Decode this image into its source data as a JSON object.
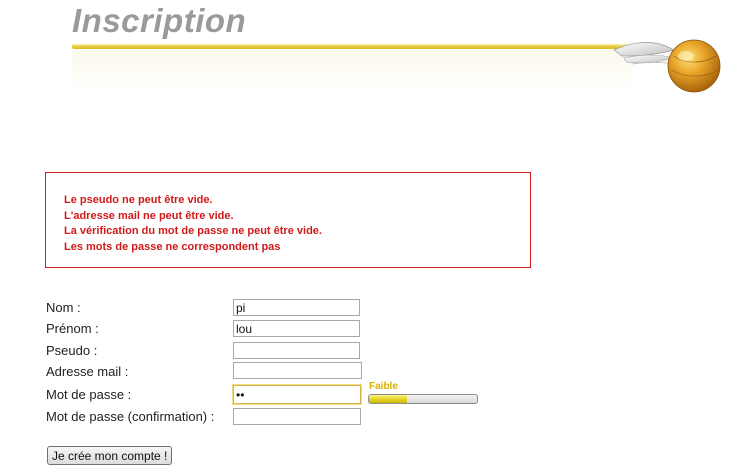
{
  "header": {
    "title": "Inscription",
    "accent_color": "#e8cf43",
    "logo_icon": "golden-snitch-icon"
  },
  "errors": [
    "Le pseudo ne peut être vide.",
    "L'adresse mail ne peut être vide.",
    "La vérification du mot de passe ne peut être vide.",
    "Les mots de passe ne correspondent pas"
  ],
  "error_color": "#d11a1a",
  "form": {
    "nom": {
      "label": "Nom :",
      "value": "pi"
    },
    "prenom": {
      "label": "Prénom :",
      "value": "lou"
    },
    "pseudo": {
      "label": "Pseudo :",
      "value": ""
    },
    "email": {
      "label": "Adresse mail :",
      "value": ""
    },
    "password": {
      "label": "Mot de passe :",
      "value": "••"
    },
    "password_confirm": {
      "label": "Mot de passe (confirmation) :",
      "value": ""
    }
  },
  "strength": {
    "label": "Faible",
    "level_percent": 35,
    "color": "#e3d21d"
  },
  "submit_label": "Je crée mon compte !"
}
